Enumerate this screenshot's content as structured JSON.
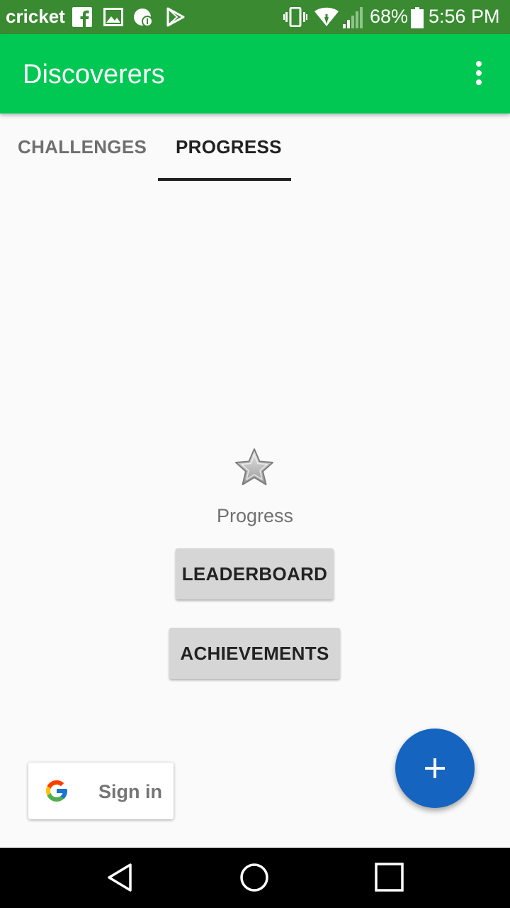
{
  "status_bar": {
    "carrier": "cricket",
    "battery": "68%",
    "time": "5:56 PM",
    "icons": [
      "facebook-icon",
      "gallery-icon",
      "android-badge-icon",
      "play-store-icon",
      "vibrate-icon",
      "wifi-icon",
      "signal-icon",
      "battery-icon"
    ]
  },
  "app_bar": {
    "title": "Discoverers",
    "menu_icon": "more-vert-icon"
  },
  "tabs": [
    {
      "label": "CHALLENGES",
      "active": false
    },
    {
      "label": "PROGRESS",
      "active": true
    }
  ],
  "progress": {
    "icon": "star-icon",
    "label": "Progress",
    "leaderboard_button": "LEADERBOARD",
    "achievements_button": "ACHIEVEMENTS"
  },
  "signin": {
    "icon": "google-icon",
    "label": "Sign in"
  },
  "fab": {
    "icon": "plus-icon",
    "color": "#1565c0"
  },
  "nav_bar": {
    "icons": [
      "back-icon",
      "home-icon",
      "recents-icon"
    ]
  },
  "colors": {
    "status_bar": "#3a8a32",
    "app_bar": "#00c853",
    "background": "#fafafa"
  }
}
